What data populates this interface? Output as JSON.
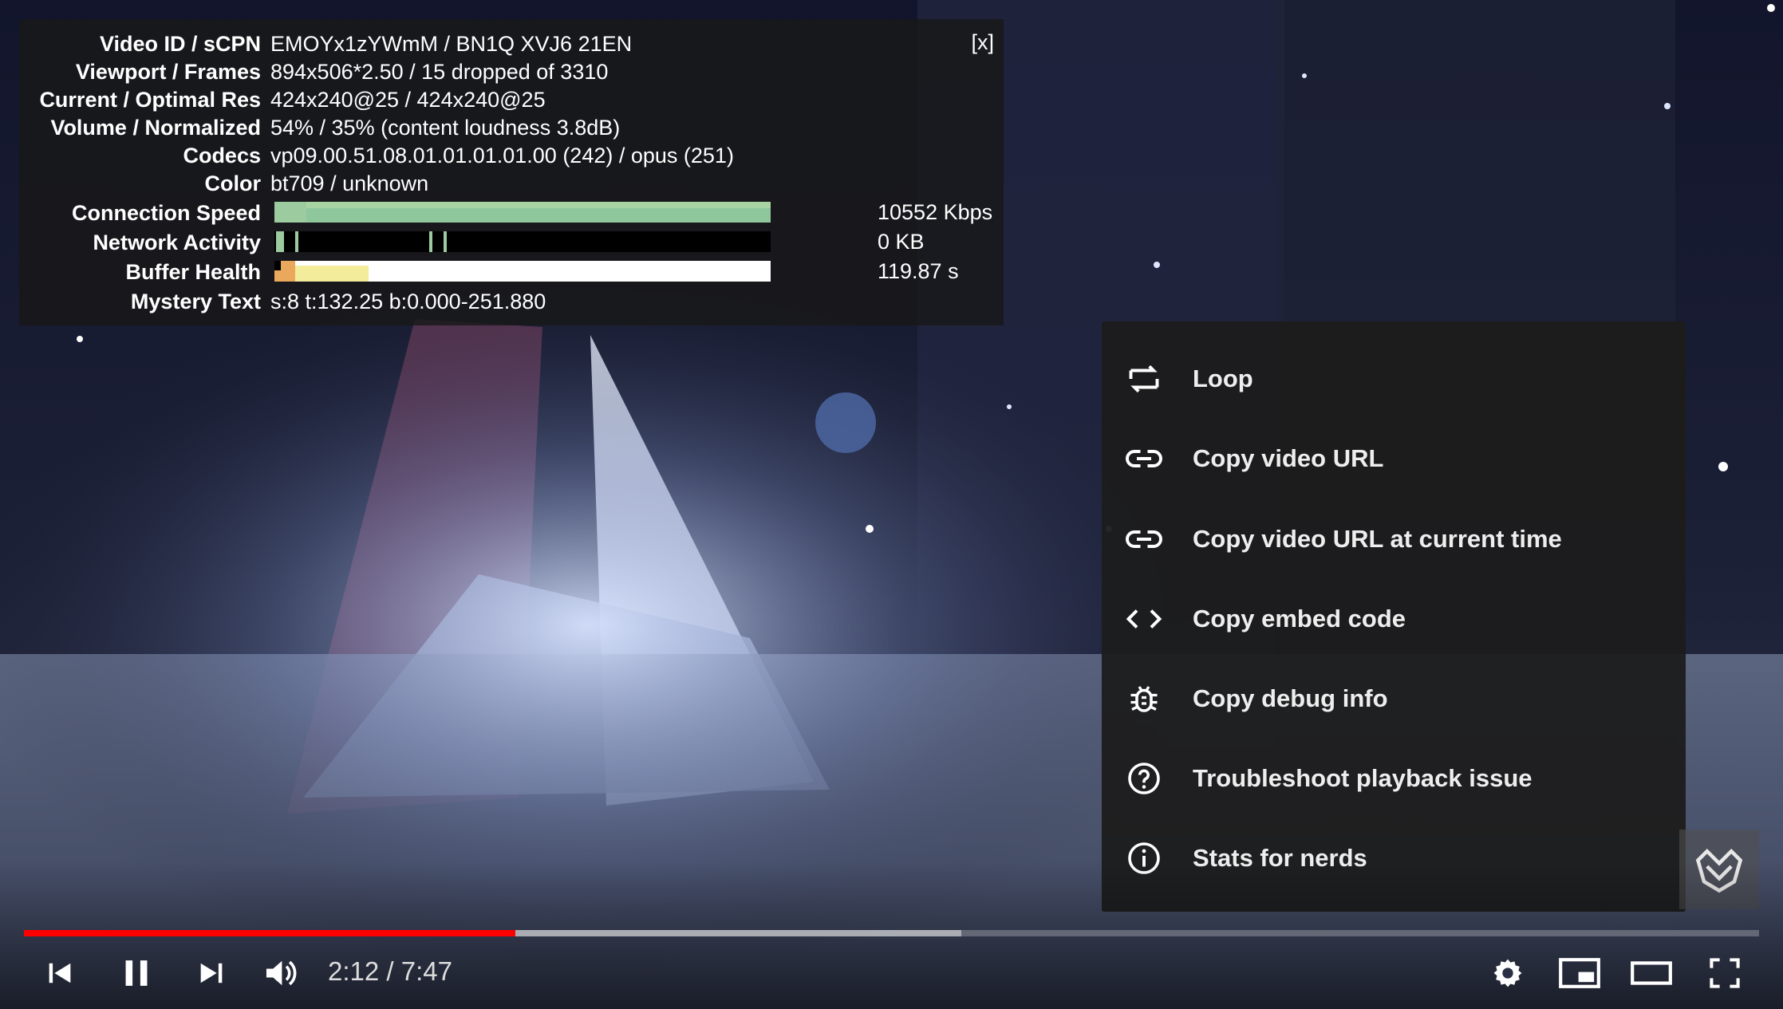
{
  "stats": {
    "close_label": "[x]",
    "rows": [
      {
        "label": "Video ID / sCPN",
        "value": "EMOYx1zYWmM / BN1Q XVJ6 21EN"
      },
      {
        "label": "Viewport / Frames",
        "value": "894x506*2.50 / 15 dropped of 3310"
      },
      {
        "label": "Current / Optimal Res",
        "value": "424x240@25 / 424x240@25"
      },
      {
        "label": "Volume / Normalized",
        "value": "54% / 35% (content loudness 3.8dB)"
      },
      {
        "label": "Codecs",
        "value": "vp09.00.51.08.01.01.01.01.00 (242) / opus (251)"
      },
      {
        "label": "Color",
        "value": "bt709 / unknown"
      }
    ],
    "graphs": [
      {
        "label": "Connection Speed",
        "value": "10552 Kbps"
      },
      {
        "label": "Network Activity",
        "value": "0 KB"
      },
      {
        "label": "Buffer Health",
        "value": "119.87 s"
      }
    ],
    "mystery": {
      "label": "Mystery Text",
      "value": "s:8 t:132.25 b:0.000-251.880"
    }
  },
  "context_menu": {
    "items": [
      {
        "label": "Loop",
        "icon": "loop-icon"
      },
      {
        "label": "Copy video URL",
        "icon": "link-icon"
      },
      {
        "label": "Copy video URL at current time",
        "icon": "link-icon"
      },
      {
        "label": "Copy embed code",
        "icon": "embed-code-icon"
      },
      {
        "label": "Copy debug info",
        "icon": "bug-icon"
      },
      {
        "label": "Troubleshoot playback issue",
        "icon": "help-circle-icon"
      },
      {
        "label": "Stats for nerds",
        "icon": "info-circle-icon"
      }
    ]
  },
  "player": {
    "current_time": "2:12",
    "duration": "7:47",
    "time_display": "2:12 / 7:47",
    "progress_fraction": 0.283,
    "buffered_fraction": 0.54,
    "colors": {
      "progress": "#ff0000",
      "menu_bg": "#1c1c1c",
      "stats_bg": "#181818"
    }
  }
}
